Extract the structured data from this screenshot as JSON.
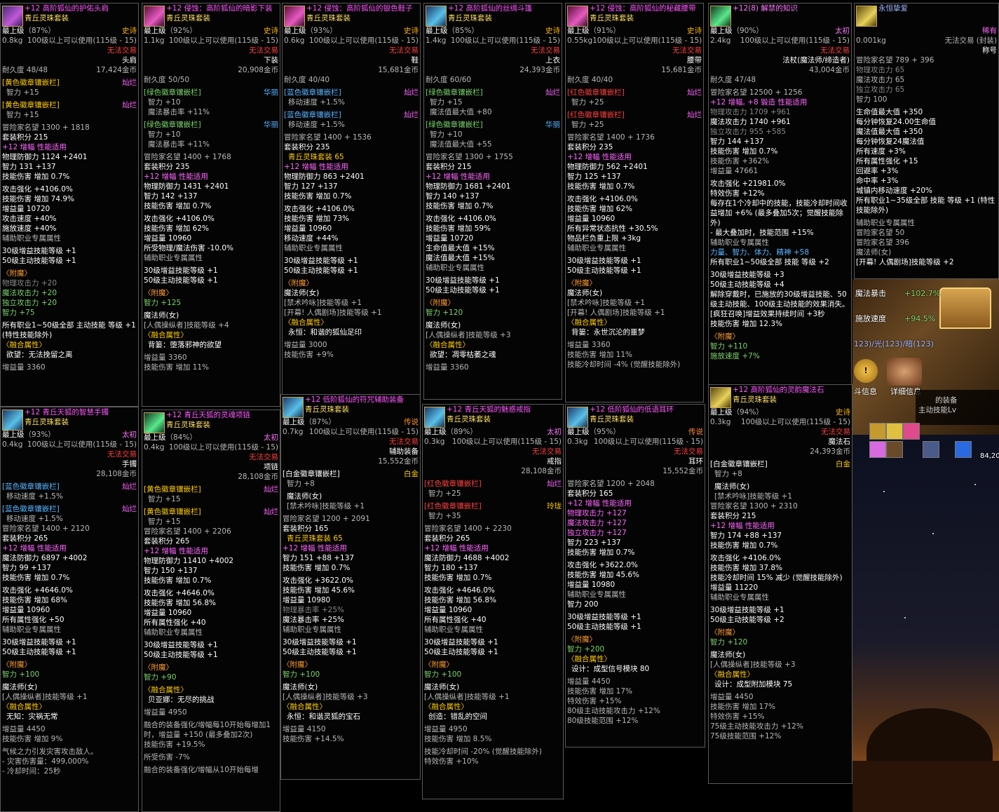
{
  "cards": {
    "c1": {
      "name": "+12 高阶狐仙的护佑头肩",
      "set": "青丘灵珠套装",
      "grade": "最上级",
      "grade_pct": "（87%）",
      "rarity": "史诗",
      "weight": "0.8kg",
      "req": "100级以上可以使用(115级 - 15)",
      "trade": "无法交易",
      "slot": "头肩",
      "price": "17,424金币",
      "dur": "耐久度 48/48",
      "emblem1": "[黄色徽章镶嵌栏]",
      "emblem1_q": "灿烂",
      "emblem1_v": "智力 +15",
      "emblem2": "[黄色徽章镶嵌栏]",
      "emblem2_q": "灿烂",
      "emblem2_v": "智力 +15",
      "fame": "冒险家名望 1300 + 1818",
      "setpt": "套装积分 215",
      "amp": "+12 增幅 性能适用",
      "def": "物理防御力 1124 +2401",
      "int": "智力 131 +137",
      "skill_dmg": "技能伤害 增加 0.7%",
      "b1": "攻击强化 +4106.0%",
      "b2": "技能伤害 增加 74.9%",
      "b3": "增益量 10720",
      "b4": "攻击速度 +40%",
      "b5": "施放速度 +40%",
      "sup": "辅助职业专属属性",
      "s1": "30级增益技能等级 +1",
      "s2": "50级主动技能等级 +1",
      "ench": "〈附魔〉",
      "e1": "物理攻击力 +20",
      "e2": "魔法攻击力 +20",
      "e3": "独立攻击力 +20",
      "e4": "智力 +75",
      "all": "所有职业1~50级全部 主动技能 等级 +1 (特性技能除外)",
      "fus": "〈融合属性〉",
      "fus1": "欲望：无法挽留之离",
      "boost": "增益量 3360"
    },
    "c2": {
      "name": "+12 侵蚀：高阶狐仙的暗影下装",
      "set": "青丘灵珠套装",
      "grade": "最上级",
      "grade_pct": "（92%）",
      "rarity": "史诗",
      "weight": "1.1kg",
      "req": "100级以上可以使用(115级 - 15)",
      "trade": "无法交易",
      "slot": "下装",
      "price": "20,908金币",
      "dur": "耐久度 50/50",
      "emblem1": "[绿色徽章镶嵌栏]",
      "emblem1_q": "华丽",
      "emblem1_v": "智力 +10",
      "emblem1_v2": "魔法暴击率 +11%",
      "emblem2": "[绿色徽章镶嵌栏]",
      "emblem2_q": "华丽",
      "emblem2_v": "智力 +10",
      "emblem2_v2": "魔法暴击率 +11%",
      "fame": "冒险家名望 1400 + 1768",
      "setpt": "套装积分 235",
      "amp": "+12 增幅 性能适用",
      "def": "物理防御力 1431 +2401",
      "int": "智力 142 +137",
      "skill_dmg": "技能伤害 增加 0.7%",
      "b1": "攻击强化 +4106.0%",
      "b2": "技能伤害 增加 62%",
      "b3": "增益量 10960",
      "b4": "所受物理/魔法伤害 -10.0%",
      "sup": "辅助职业专属属性",
      "s1": "30级增益技能等级 +1",
      "s2": "50级主动技能等级 +1",
      "ench": "〈附魔〉",
      "e1": "智力 +125",
      "job": "魔法师(女)",
      "job1": "[人偶操纵者]技能等级 +4",
      "fus": "〈融合属性〉",
      "fus1": "背篓：堕落邪神的欲望",
      "boost": "增益量 3360",
      "boost2": "技能伤害 增加 11%"
    },
    "c3": {
      "name": "+12 侵蚀：高阶狐仙的银色鞋子",
      "set": "青丘灵珠套装",
      "grade": "最上级",
      "grade_pct": "（93%）",
      "rarity": "史诗",
      "weight": "0.6kg",
      "req": "100级以上可以使用(115级 - 15)",
      "trade": "无法交易",
      "slot": "鞋",
      "price": "15,681金币",
      "dur": "耐久度 40/40",
      "emblem1": "[蓝色徽章镶嵌栏]",
      "emblem1_q": "灿烂",
      "emblem1_v": "移动速度 +1.5%",
      "emblem2": "[蓝色徽章镶嵌栏]",
      "emblem2_q": "灿烂",
      "emblem2_v": "移动速度 +1.5%",
      "fame": "冒险家名望 1400 + 1536",
      "setpt": "套装积分 235",
      "setname": "青丘灵珠套装 65",
      "amp": "+12 增幅 性能适用",
      "def": "物理防御力 863 +2401",
      "int": "智力 127 +137",
      "skill_dmg": "技能伤害 增加 0.7%",
      "b1": "攻击强化 +4106.0%",
      "b2": "技能伤害 增加 73%",
      "b3": "增益量 10960",
      "b4": "移动速度 +44%",
      "sup": "辅助职业专属属性",
      "s1": "30级增益技能等级 +1",
      "s2": "50级主动技能等级 +1",
      "ench": "〈附魔〉",
      "job": "魔法师(女)",
      "job1": "[禁术吟咏]技能等级 +1",
      "job2": "[开幕! 人偶剧场]技能等级 +1",
      "fus": "〈融合属性〉",
      "fus1": "永恒：和谐的狐仙足印",
      "boost": "增益量 3000",
      "boost2": "技能伤害 +9%"
    },
    "c4": {
      "name": "+12 高阶狐仙的丝绸斗篷",
      "set": "青丘灵珠套装",
      "grade": "最上级",
      "grade_pct": "（85%）",
      "rarity": "史诗",
      "weight": "1.4kg",
      "req": "100级以上可以使用(115级 - 15)",
      "trade": "无法交易",
      "slot": "上衣",
      "price": "24,393金币",
      "dur": "耐久度 60/60",
      "emblem1": "[绿色徽章镶嵌栏]",
      "emblem1_q": "灿烂",
      "emblem1_v": "智力 +15",
      "emblem1_v2": "魔法值最大值 +80",
      "emblem2": "[绿色徽章镶嵌栏]",
      "emblem2_q": "华丽",
      "emblem2_v": "智力 +10",
      "emblem2_v2": "魔法值最大值 +55",
      "fame": "冒险家名望 1300 + 1755",
      "setpt": "套装积分 215",
      "amp": "+12 增幅 性能适用",
      "def": "物理防御力 1681 +2401",
      "int": "智力 140 +137",
      "skill_dmg": "技能伤害 增加 0.7%",
      "b1": "攻击强化 +4106.0%",
      "b2": "技能伤害 增加 59%",
      "b3": "增益量 10720",
      "b4": "生命值最大值 +15%",
      "b5": "魔法值最大值 +15%",
      "sup": "辅助职业专属属性",
      "s1": "30级增益技能等级 +1",
      "s2": "50级主动技能等级 +1",
      "ench": "〈附魔〉",
      "e1": "智力 +120",
      "job": "魔法师(女)",
      "job1": "[人偶操纵者]技能等级 +3",
      "fus": "〈融合属性〉",
      "fus1": "欲望：凋零枯萎之魂",
      "boost": "增益量 3360"
    },
    "c5": {
      "name": "+12 侵蚀：高阶狐仙的秘藏腰带",
      "set": "青丘灵珠套装",
      "grade": "最上级",
      "grade_pct": "（91%）",
      "rarity": "史诗",
      "weight": "0.55kg",
      "req": "100级以上可以使用(115级 - 15)",
      "trade": "无法交易",
      "slot": "腰带",
      "price": "15,681金币",
      "dur": "耐久度 40/40",
      "emblem1": "[红色徽章镶嵌栏]",
      "emblem1_q": "灿烂",
      "emblem1_v": "智力 +25",
      "emblem2": "[红色徽章镶嵌栏]",
      "emblem2_q": "灿烂",
      "emblem2_v": "智力 +25",
      "fame": "冒险家名望 1400 + 1736",
      "setpt": "套装积分 235",
      "amp": "+12 增幅 性能适用",
      "def": "物理防御力 562 +2401",
      "int": "智力 125 +137",
      "skill_dmg": "技能伤害 增加 0.7%",
      "b1": "攻击强化 +4106.0%",
      "b2": "技能伤害 增加 62%",
      "b3": "增益量 10960",
      "b4": "所有异常状态抗性 +30.5%",
      "b5": "物品栏负重上限 +3kg",
      "sup": "辅助职业专属属性",
      "s1": "30级增益技能等级 +1",
      "s2": "50级主动技能等级 +1",
      "ench": "〈附魔〉",
      "job": "魔法师(女)",
      "job1": "[禁术吟咏]技能等级 +1",
      "job2": "[开幕! 人偶剧场]技能等级 +1",
      "fus": "〈融合属性〉",
      "fus1": "背篓：永世沉沦的噩梦",
      "boost": "增益量 3360",
      "boost2": "技能伤害 增加 11%",
      "boost3": "技能冷却时间 -4% (觉醒技能除外)"
    },
    "c6": {
      "name": "+12(8) 解禁的知识",
      "grade": "最上级",
      "grade_pct": "（90%）",
      "rarity": "太初",
      "weight": "2.4kg",
      "req": "100级以上可以使用(115级 - 15)",
      "trade": "无法交易",
      "slot": "法杖(魔法师/缔造者)",
      "price": "43,004金币",
      "dur": "耐久度 47/48",
      "fame": "冒险家名望 12500 + 1256",
      "amp": "+12 增幅, +8 锻造 性能适用",
      "a1": "物理攻击力 1709 +961",
      "a2": "魔法攻击力 1740 +961",
      "a3": "独立攻击力 955 +585",
      "int": "智力 144 +137",
      "skill_dmg": "技能伤害 增加 0.7%",
      "a4": "技能伤害 +362%",
      "a5": "增益量 47661",
      "b1": "攻击强化 +21981.0%",
      "b2": "特效伤害 +12%",
      "b3": "每存在1个冷却中的技能，技能冷却时间收益增加 +6% (最多叠加5次；觉醒技能除外)",
      "b4": "- 最大叠加时，技能范围 +15%",
      "sup": "辅助职业专属属性",
      "s0": "力量、智力、体力、精神 +58",
      "s0b": "所有职业1~50级全部 技能 等级 +2",
      "s1": "30级增益技能等级 +3",
      "s2": "50级主动技能等级 +4",
      "s3": "解除穿戴时，已施放的30级增益技能、50级主动技能、100级主动技能的效果消失。",
      "s4": "[疯狂召唤]增益效果持续时间 +3秒",
      "s5": "技能伤害 增加 12.3%",
      "ench": "〈附魔〉",
      "e1": "智力 +110",
      "e2": "施放速度 +7%"
    },
    "c7": {
      "name": "永恒挚爱",
      "rarity": "稀有",
      "weight": "0.001kg",
      "trade": "无法交易 (封装)",
      "slot": "称号",
      "fame": "冒险家名望 789 + 396",
      "a1": "物理攻击力 65",
      "a2": "魔法攻击力 65",
      "a3": "独立攻击力 65",
      "a4": "智力 100",
      "b1": "生命值最大值 +350",
      "b2": "每分钟恢复24.00生命值",
      "b3": "魔法值最大值 +350",
      "b4": "每分钟恢复24魔法值",
      "b5": "所有速度 +3%",
      "b6": "所有属性强化 +15",
      "b7": "回避率 +3%",
      "b8": "命中率 +3%",
      "b9": "城镇内移动速度 +20%",
      "b10": "所有职业1~35级全部 技能 等级 +1 (特性技能除外)",
      "sup": "辅助职业专属属性",
      "s1": "冒险家名望 50",
      "fame2": "冒险家名望 396",
      "job": "魔法师(女)",
      "job1": "[开幕! 人偶剧场]技能等级 +2"
    },
    "c8": {
      "name": "+12 青丘天狐的智慧手镯",
      "set": "青丘灵珠套装",
      "grade": "最上级",
      "grade_pct": "（93%）",
      "rarity": "太初",
      "weight": "0.4kg",
      "req": "100级以上可以使用(115级 - 15)",
      "trade": "无法交易",
      "slot": "手镯",
      "price": "28,108金币",
      "emblem1": "[蓝色徽章镶嵌栏]",
      "emblem1_q": "灿烂",
      "emblem1_v": "移动速度 +1.5%",
      "emblem2": "[蓝色徽章镶嵌栏]",
      "emblem2_q": "灿烂",
      "emblem2_v": "移动速度 +1.5%",
      "fame": "冒险家名望 1400 + 2120",
      "setpt": "套装积分 265",
      "amp": "+12 增幅 性能适用",
      "def": "魔法防御力 6897 +4002",
      "int": "智力 99 +137",
      "skill_dmg": "技能伤害 增加 0.7%",
      "b1": "攻击强化 +4646.0%",
      "b2": "技能伤害 增加 68%",
      "b3": "增益量 10960",
      "b4": "所有属性强化 +50",
      "sup": "辅助职业专属属性",
      "s1": "30级增益技能等级 +1",
      "s2": "50级主动技能等级 +1",
      "ench": "〈附魔〉",
      "e1": "智力 +100",
      "job": "魔法师(女)",
      "job1": "[人偶操纵者]技能等级 +1",
      "fus": "〈融合属性〉",
      "fus1": "无知：灾祸无常",
      "boost": "增益量 4450",
      "boost2": "技能伤害 增加 9%",
      "x1": "气候之力引发灾害攻击敌人。",
      "x2": "- 灾害伤害量：499,000%",
      "x3": "- 冷却时间：25秒"
    },
    "c9": {
      "name": "+12 青丘天狐的灵魂项链",
      "set": "青丘灵珠套装",
      "grade": "最上级",
      "grade_pct": "（84%）",
      "rarity": "太初",
      "weight": "0.4kg",
      "req": "100级以上可以使用(115级 - 15)",
      "trade": "无法交易",
      "slot": "项链",
      "price": "28,108金币",
      "emblem1": "[黄色徽章镶嵌栏]",
      "emblem1_q": "灿烂",
      "emblem1_v": "智力 +15",
      "emblem2": "[黄色徽章镶嵌栏]",
      "emblem2_q": "灿烂",
      "emblem2_v": "智力 +15",
      "fame": "冒险家名望 1400 + 2206",
      "setpt": "套装积分 265",
      "amp": "+12 增幅 性能适用",
      "def": "物理防御力 11410 +4002",
      "int": "智力 150 +137",
      "skill_dmg": "技能伤害 增加 0.7%",
      "b1": "攻击强化 +4646.0%",
      "b2": "技能伤害 增加 56.8%",
      "b3": "增益量 10960",
      "b4": "所有属性强化 +40",
      "sup": "辅助职业专属属性",
      "s1": "30级增益技能等级 +1",
      "s2": "50级主动技能等级 +1",
      "ench": "〈附魔〉",
      "e1": "智力 +90",
      "fus": "〈融合属性〉",
      "fus1": "贝亚娜：无尽的挑战",
      "boost": "增益量 4950",
      "x1": "融合的装备强化/增幅每10开始每增加1时，增益量 +150 (最多叠加2次)",
      "x2": "技能伤害 +19.5%",
      "x3": "所受伤害 -7%",
      "x4": "融合的装备强化/增幅从10开始每增"
    },
    "c10": {
      "name": "+12 低阶狐仙的符咒辅助装备",
      "set": "青丘灵珠套装",
      "grade": "最上级",
      "grade_pct": "（87%）",
      "rarity": "传说",
      "weight": "0.7kg",
      "req": "100级以上可以使用(115级 - 15)",
      "trade": "无法交易",
      "slot": "辅助装备",
      "price": "15,552金币",
      "emblem1": "[白金徽章镶嵌栏]",
      "emblem1_q": "白金",
      "emblem1_v": "智力 +8",
      "job": "魔法师(女)",
      "job1": "[禁术吟咏]技能等级 +1",
      "fame": "冒险家名望 1200 + 2091",
      "setpt": "套装积分 165",
      "setname": "青丘灵珠套装 65",
      "amp": "+12 增幅 性能适用",
      "int": "智力 151 +88 +137",
      "skill_dmg": "技能伤害 增加 0.7%",
      "b1": "攻击强化 +3622.0%",
      "b2": "技能伤害 增加 45.6%",
      "b3": "增益量 10980",
      "b4": "物理暴击率 +25%",
      "b5": "魔法暴击率 +25%",
      "sup": "辅助职业专属属性",
      "s1": "30级增益技能等级 +1",
      "s2": "50级主动技能等级 +1",
      "ench": "〈附魔〉",
      "e1": "智力 +100",
      "job2": "魔法师(女)",
      "job2b": "[人偶操纵者]技能等级 +3",
      "fus": "〈融合属性〉",
      "fus1": "永恒：和谐灵狐的宝石",
      "boost": "增益量 4150",
      "boost2": "技能伤害 +14.5%"
    },
    "c11": {
      "name": "+12 青丘天狐的魅惑戒指",
      "set": "青丘灵珠套装",
      "grade": "最上级",
      "grade_pct": "（89%）",
      "rarity": "太初",
      "weight": "0.3kg",
      "req": "100级以上可以使用(115级 - 15)",
      "trade": "无法交易",
      "slot": "戒指",
      "price": "28,108金币",
      "emblem1": "[红色徽章镶嵌栏]",
      "emblem1_q": "灿烂",
      "emblem1_v": "智力 +25",
      "emblem2": "[红色徽章镶嵌栏]",
      "emblem2_q": "玲珑",
      "emblem2_v": "智力 +35",
      "fame": "冒险家名望 1400 + 2230",
      "setpt": "套装积分 265",
      "amp": "+12 增幅 性能适用",
      "def": "魔法防御力 4688 +4002",
      "int": "智力 180 +137",
      "skill_dmg": "技能伤害 增加 0.7%",
      "b1": "攻击强化 +4646.0%",
      "b2": "技能伤害 增加 56.8%",
      "b3": "增益量 10960",
      "b4": "所有属性强化 +40",
      "sup": "辅助职业专属属性",
      "s1": "30级增益技能等级 +1",
      "s2": "50级主动技能等级 +1",
      "ench": "〈附魔〉",
      "e1": "智力 +100",
      "job": "魔法师(女)",
      "job1": "[人偶操纵者]技能等级 +1",
      "fus": "〈融合属性〉",
      "fus1": "创造：错乱的空间",
      "boost": "增益量 4950",
      "boost2": "技能伤害 增加 8.5%",
      "x1": "技能冷却时间 -20% (觉醒技能除外)",
      "x2": "特效伤害 +10%"
    },
    "c12": {
      "name": "+12 低阶狐仙的低语耳环",
      "set": "青丘灵珠套装",
      "grade": "最上级",
      "grade_pct": "（95%）",
      "rarity": "传说",
      "weight": "0.3kg",
      "req": "100级以上可以使用(115级 - 15)",
      "trade": "无法交易",
      "slot": "耳环",
      "price": "15,552金币",
      "fame": "冒险家名望 1200 + 2048",
      "setpt": "套装积分 165",
      "amp": "+12 增幅 性能适用",
      "a1": "物理攻击力 +127",
      "a2": "魔法攻击力 +127",
      "a3": "独立攻击力 +127",
      "int": "智力 223 +137",
      "skill_dmg": "技能伤害 增加 0.7%",
      "b1": "攻击强化 +3622.0%",
      "b2": "技能伤害 增加 45.6%",
      "b3": "增益量 10980",
      "sup": "辅助职业专属属性",
      "s0": "智力 200",
      "s1": "30级增益技能等级 +1",
      "s2": "50级主动技能等级 +1",
      "ench": "〈附魔〉",
      "e1": "智力 +200",
      "fus": "〈融合属性〉",
      "fus1": "设计：成型信号模块 80",
      "boost": "增益量 4450",
      "boost2": "技能伤害 增加 17%",
      "x1": "特效伤害 +15%",
      "x2": "80级主动技能攻击力 +12%",
      "x3": "80级技能范围 +12%"
    },
    "c13": {
      "name": "+12 高阶狐仙的灵韵魔法石",
      "set": "青丘灵珠套装",
      "grade": "最上级",
      "grade_pct": "（94%）",
      "rarity": "史诗",
      "weight": "0.3kg",
      "req": "100级以上可以使用(115级 - 15)",
      "trade": "无法交易",
      "slot": "魔法石",
      "price": "24,393金币",
      "emblem1": "[白金徽章镶嵌栏]",
      "emblem1_q": "白金",
      "emblem1_v": "智力 +8",
      "job": "魔法师(女)",
      "job1": "[禁术吟咏]技能等级 +1",
      "fame": "冒险家名望 1300 + 2310",
      "setpt": "套装积分 215",
      "amp": "+12 增幅 性能适用",
      "int": "智力 174 +88 +137",
      "skill_dmg": "技能伤害 增加 0.7%",
      "b1": "攻击强化 +4106.0%",
      "b2": "技能伤害 增加 37.8%",
      "b3": "技能冷却时间 15% 减少 (觉醒技能除外)",
      "b4": "增益量 11220",
      "sup": "辅助职业专属属性",
      "s1": "30级增益技能等级 +1",
      "s2": "50级主动技能等级 +2",
      "ench": "〈附魔〉",
      "e1": "智力 +120",
      "job2": "魔法师(女)",
      "job2b": "[人偶操纵者]技能等级 +3",
      "fus": "〈融合属性〉",
      "fus1": "设计：成型附加模块 75",
      "boost": "增益量 4450",
      "boost2": "技能伤害 增加 17%",
      "x1": "特效伤害 +15%",
      "x2": "75级主动技能攻击力 +12%",
      "x3": "75级技能范围 +12%"
    }
  },
  "overlay": {
    "strip1": "魔法暴击",
    "strip1v": "+102.7%",
    "strip2": "施放速度",
    "strip2v": "+94.5%",
    "strip3": "123)/光(123)/暗(123)",
    "btn1": "斗信息",
    "btn2": "详细信息",
    "note1": "的装备",
    "note2": "主动技能Lv",
    "num": "84,20"
  }
}
